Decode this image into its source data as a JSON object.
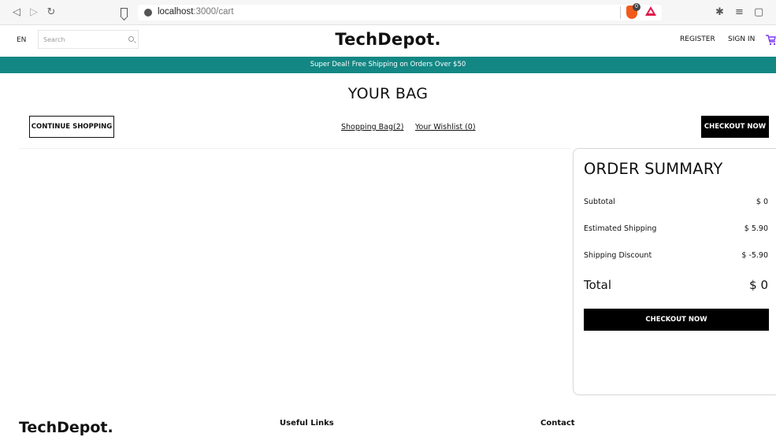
{
  "browser": {
    "url_host": "localhost",
    "url_path": ":3000/cart",
    "shields_count": "0",
    "icons": [
      "back-icon",
      "forward-icon",
      "reload-icon",
      "bookmark-icon",
      "site-info-icon",
      "brave-shields-icon",
      "brave-rewards-icon",
      "extensions-icon",
      "playlist-icon",
      "wallet-icon"
    ]
  },
  "header": {
    "language": "EN",
    "search_placeholder": "Search",
    "logo": "TechDepot.",
    "register": "REGISTER",
    "sign_in": "SIGN IN"
  },
  "banner": {
    "text": "Super Deal! Free Shipping on Orders Over $50",
    "color": "#138784"
  },
  "bag": {
    "title": "YOUR BAG",
    "continue_label": "CONTINUE SHOPPING",
    "shopping_bag_link": "Shopping Bag(2)",
    "wishlist_link": "Your Wishlist (0)",
    "checkout_label": "CHECKOUT NOW"
  },
  "summary": {
    "title": "ORDER SUMMARY",
    "rows": [
      {
        "label": "Subtotal",
        "value": "$ 0"
      },
      {
        "label": "Estimated Shipping",
        "value": "$ 5.90"
      },
      {
        "label": "Shipping Discount",
        "value": "$ -5.90"
      }
    ],
    "total_label": "Total",
    "total_value": "$ 0",
    "checkout_label": "CHECKOUT NOW"
  },
  "footer": {
    "logo": "TechDepot.",
    "useful_links": "Useful Links",
    "contact": "Contact"
  }
}
